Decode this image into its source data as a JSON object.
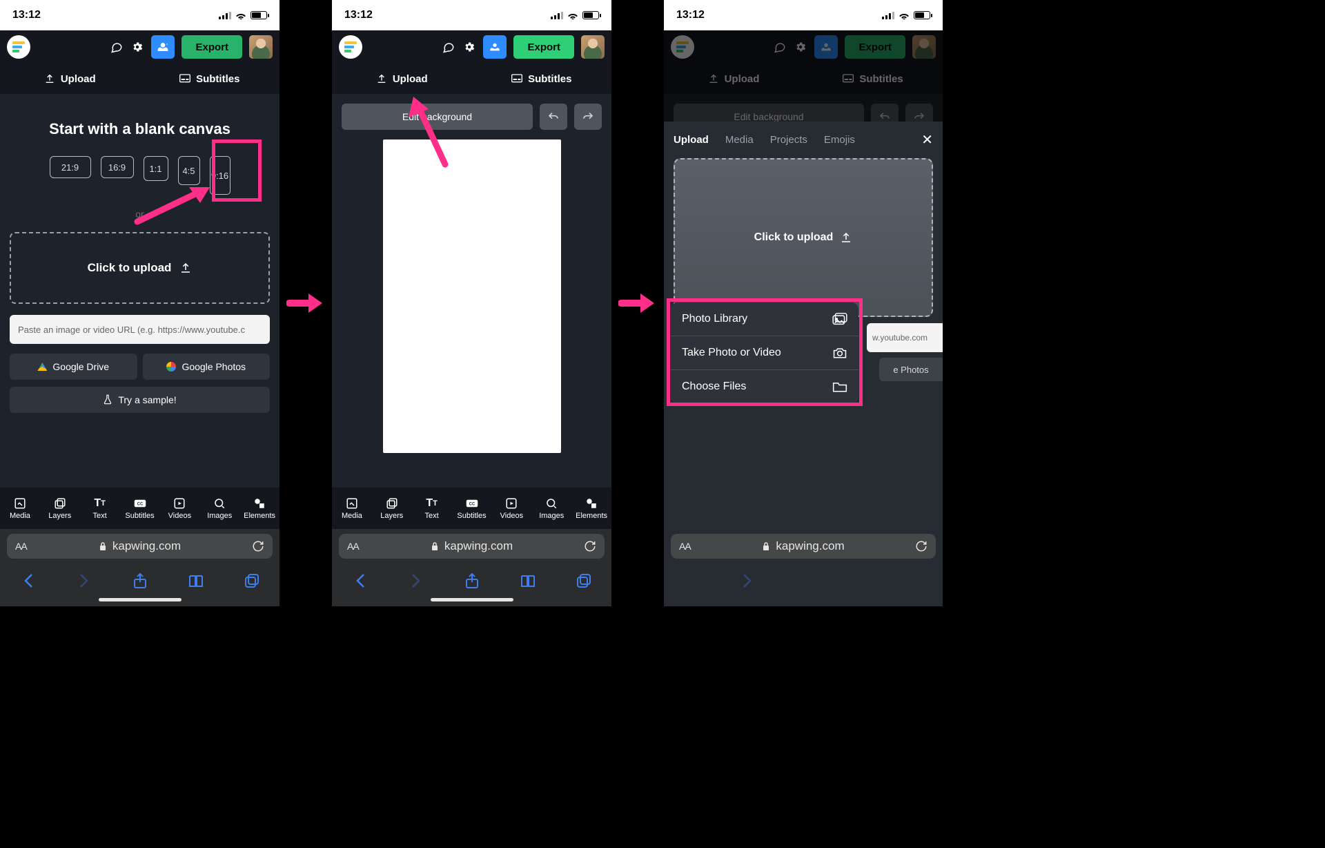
{
  "status": {
    "time": "13:12"
  },
  "header": {
    "export": "Export"
  },
  "tabs": {
    "upload": "Upload",
    "subtitles": "Subtitles"
  },
  "screen1": {
    "title": "Start with a blank canvas",
    "ratios": [
      "21:9",
      "16:9",
      "1:1",
      "4:5",
      "9:16"
    ],
    "or": "or",
    "click_upload": "Click to upload",
    "url_placeholder": "Paste an image or video URL (e.g. https://www.youtube.c",
    "drive": "Google Drive",
    "photos": "Google Photos",
    "sample": "Try a sample!"
  },
  "screen2": {
    "edit_bg": "Edit background"
  },
  "screen3": {
    "modal_tabs": [
      "Upload",
      "Media",
      "Projects",
      "Emojis"
    ],
    "click_upload": "Click to upload",
    "url_stub": "w.youtube.com",
    "gphotos_stub": "e Photos",
    "sheet": {
      "photo_library": "Photo Library",
      "take_photo": "Take Photo or Video",
      "choose_files": "Choose Files"
    }
  },
  "toolbar": [
    "Media",
    "Layers",
    "Text",
    "Subtitles",
    "Videos",
    "Images",
    "Elements"
  ],
  "browser": {
    "domain": "kapwing.com"
  }
}
